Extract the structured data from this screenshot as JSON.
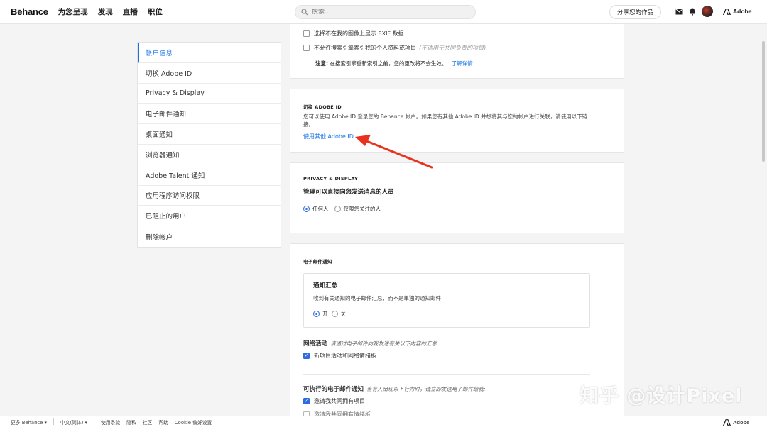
{
  "topbar": {
    "logo": "Bēhance",
    "nav": [
      "为您呈现",
      "发现",
      "直播",
      "职位"
    ],
    "search_placeholder": "搜索...",
    "share_label": "分享您的作品",
    "adobe_label": "Adobe"
  },
  "sidebar": {
    "items": [
      {
        "label": "帐户信息",
        "active": true
      },
      {
        "label": "切换 Adobe ID"
      },
      {
        "label": "Privacy & Display"
      },
      {
        "label": "电子邮件通知"
      },
      {
        "label": "桌面通知"
      },
      {
        "label": "浏览器通知"
      },
      {
        "label": "Adobe Talent 通知"
      },
      {
        "label": "应用程序访问权限"
      },
      {
        "label": "已阻止的用户"
      },
      {
        "label": "删除帐户"
      }
    ]
  },
  "card1": {
    "exif_label": "选择不在我的图像上显示 EXIF 数据",
    "index_label": "不允许搜索引擎索引我的个人资料或项目",
    "index_hint": "(不适用于共同负责的项目)",
    "note_prefix": "注意:",
    "note_text": "在搜索引擎重新索引之前，您的更改将不会生效。",
    "note_link": "了解详情"
  },
  "card2": {
    "title": "切换 ADOBE ID",
    "para": "您可以使用 Adobe ID 登录您的 Behance 帐户。如果您有其他 Adobe ID 并想将其与您的帐户进行关联，请使用以下链接。",
    "link": "使用其他 Adobe ID"
  },
  "card3": {
    "title": "PRIVACY & DISPLAY",
    "heading": "管理可以直接向您发送消息的人员",
    "opt_anyone": "任何人",
    "opt_following": "仅限您关注的人"
  },
  "card4": {
    "title": "电子邮件通知",
    "digest_heading": "通知汇总",
    "digest_desc": "收到有关通知的电子邮件汇总，而不是单独的通知邮件",
    "opt_on": "开",
    "opt_off": "关",
    "network_heading": "网络活动",
    "network_hint": "请通过电子邮件向我发送有关以下内容的汇总:",
    "network_item": "新项目活动和网络情绪板",
    "action_heading": "可执行的电子邮件通知",
    "action_hint": "当有人出现以下行为时，请立即发送电子邮件给我:",
    "action_item1": "邀请我共同拥有项目",
    "action_item2": "邀请我共同拥有情绪板"
  },
  "footer": {
    "more": "更多 Behance ▾",
    "lang": "中文(简体) ▾",
    "terms": "使用条款",
    "privacy": "隐私",
    "community": "社区",
    "help": "帮助",
    "cookie": "Cookie 偏好设置",
    "adobe": "Adobe"
  },
  "watermark": "知乎 @设计Pixel",
  "colors": {
    "accent": "#1473e6",
    "arrow": "#e8321e"
  }
}
